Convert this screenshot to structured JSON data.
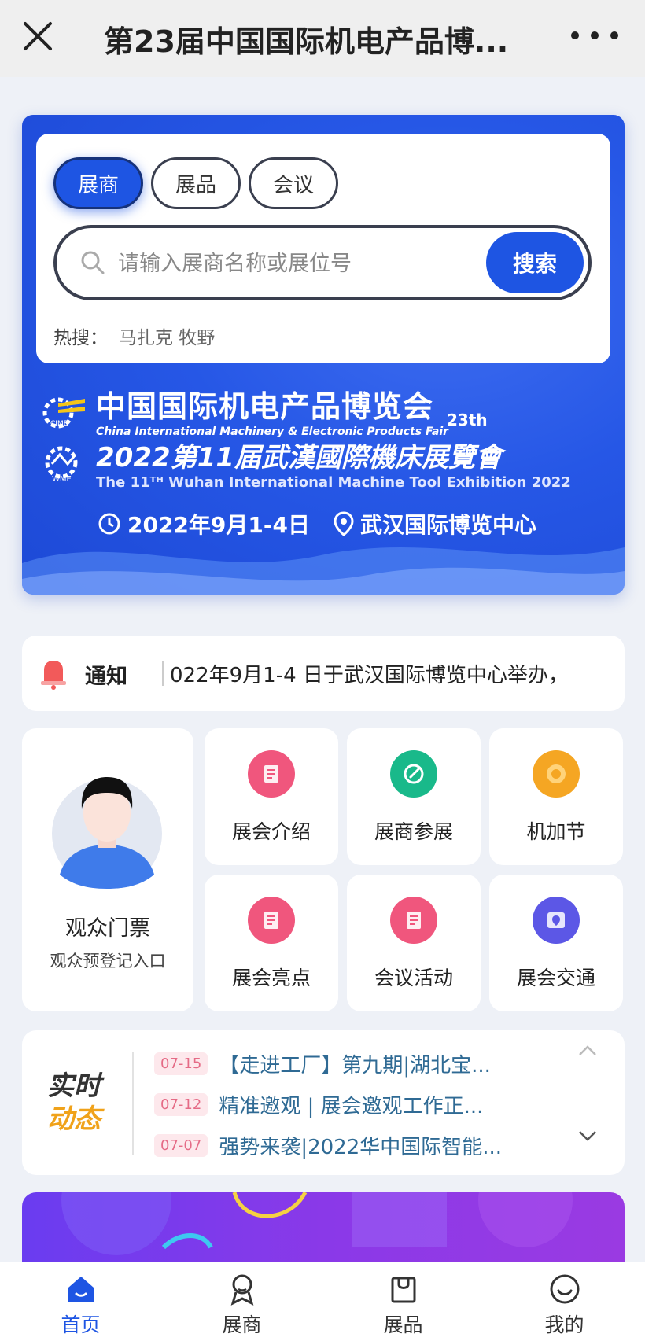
{
  "topbar": {
    "title": "第23届中国国际机电产品博...",
    "close_icon": "close-icon",
    "more_icon": "more-dots-icon"
  },
  "search": {
    "tabs": [
      {
        "label": "展商",
        "active": true
      },
      {
        "label": "展品",
        "active": false
      },
      {
        "label": "会议",
        "active": false
      }
    ],
    "placeholder": "请输入展商名称或展位号",
    "button": "搜索",
    "hot_label": "热搜：",
    "hot_tags": "马扎克 牧野"
  },
  "banner": {
    "title_zh": "中国国际机电产品博览会",
    "title_en": "China International Machinery & Electronic Products Fair",
    "edition": "23th",
    "logo1": "CIME",
    "title2_zh": "2022第11届武漢國際機床展覽會",
    "title2_en": "The 11ᵀᴴ Wuhan International Machine Tool Exhibition 2022",
    "logo2": "WME",
    "date": "2022年9月1-4日",
    "venue": "武汉国际博览中心",
    "colors": {
      "primary": "#1e55e3"
    }
  },
  "notice": {
    "label": "通知",
    "text": "022年9月1-4 日于武汉国际博览中心举办，"
  },
  "ticket": {
    "title": "观众门票",
    "subtitle": "观众预登记入口"
  },
  "tiles": [
    {
      "label": "展会介绍",
      "icon": "document-icon",
      "color": "#f0567d"
    },
    {
      "label": "展商参展",
      "icon": "compass-icon",
      "color": "#19b98a"
    },
    {
      "label": "机加节",
      "icon": "flower-icon",
      "color": "#f5a623"
    },
    {
      "label": "展会亮点",
      "icon": "document-icon",
      "color": "#f0567d"
    },
    {
      "label": "会议活动",
      "icon": "document-icon",
      "color": "#f0567d"
    },
    {
      "label": "展会交通",
      "icon": "map-icon",
      "color": "#5c57e6"
    }
  ],
  "news": {
    "live_a": "实时",
    "live_b": "动态",
    "items": [
      {
        "date": "07-15",
        "title": "【走进工厂】第九期|湖北宝..."
      },
      {
        "date": "07-12",
        "title": "精准邀观 | 展会邀观工作正..."
      },
      {
        "date": "07-07",
        "title": "强势来袭|2022华中国际智能..."
      }
    ]
  },
  "bottomnav": [
    {
      "label": "首页",
      "icon": "home-icon",
      "active": true
    },
    {
      "label": "展商",
      "icon": "exhibitor-icon",
      "active": false
    },
    {
      "label": "展品",
      "icon": "bag-icon",
      "active": false
    },
    {
      "label": "我的",
      "icon": "smile-icon",
      "active": false
    }
  ]
}
